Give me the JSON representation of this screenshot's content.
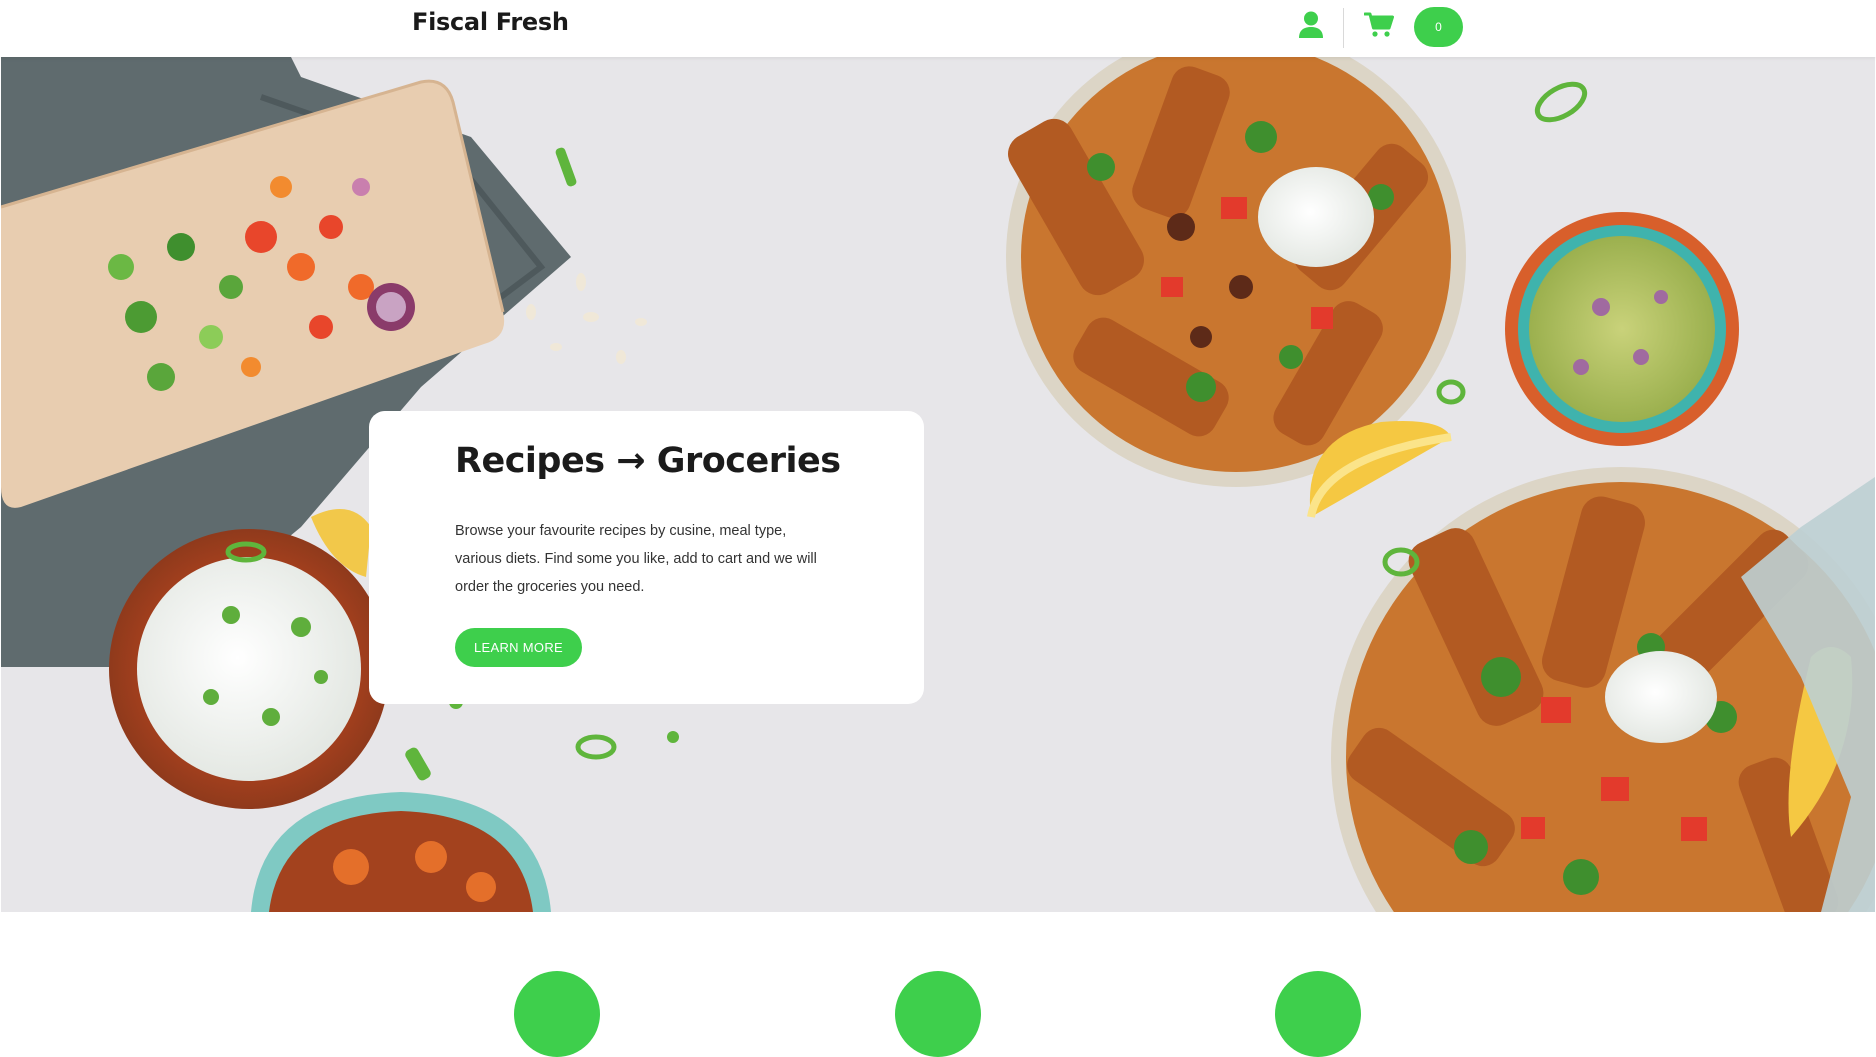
{
  "header": {
    "brand": "Fiscal Fresh",
    "cart_count": "0",
    "icons": [
      "user-icon",
      "cart-icon"
    ]
  },
  "hero": {
    "title": "Recipes → Groceries",
    "description": "Browse your favourite recipes by cusine, meal type, various diets. Find some you like, add to cart and we will order the groceries you need.",
    "cta_label": "LEARN MORE"
  },
  "colors": {
    "accent": "#3ecf4c",
    "background": "#e7e6e9",
    "text": "#1b1b1b"
  }
}
